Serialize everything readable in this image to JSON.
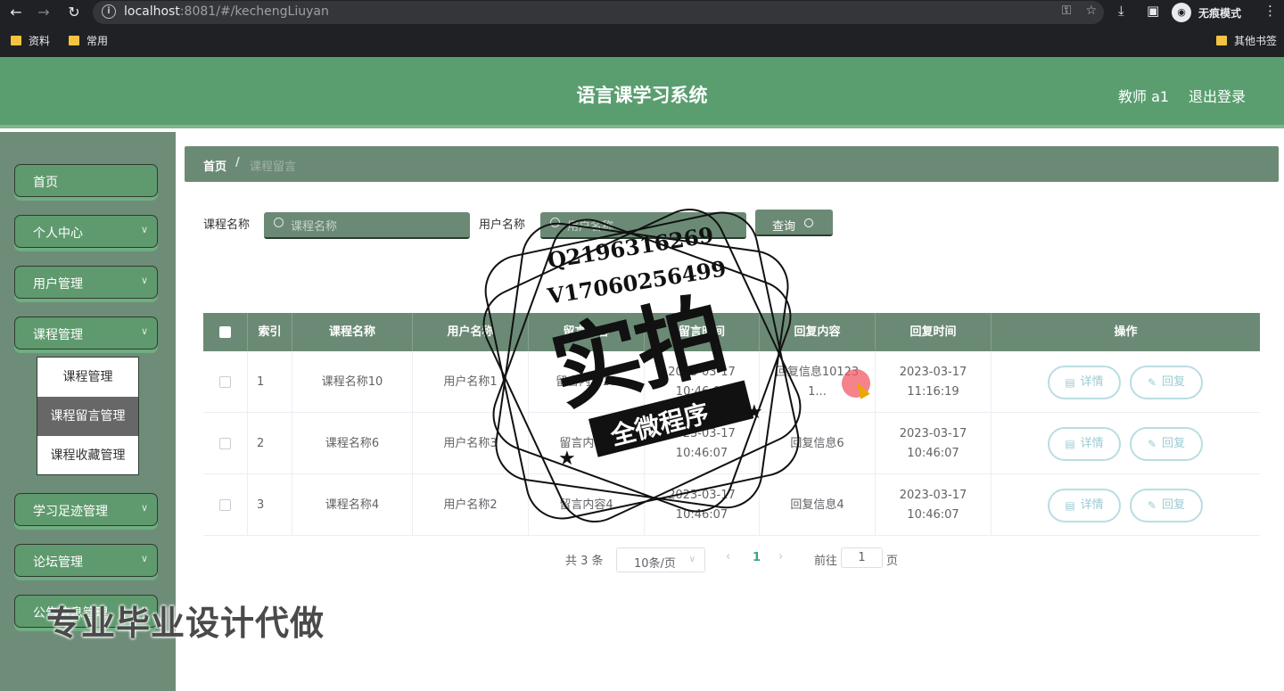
{
  "browser": {
    "url_host": "localhost",
    "url_rest": ":8081/#/kechengLiuyan",
    "incognito_label": "无痕模式",
    "bookmarks": [
      "资料",
      "常用",
      "其他书签"
    ]
  },
  "header": {
    "title": "语言课学习系统",
    "user": "教师 a1",
    "logout": "退出登录"
  },
  "sidebar": {
    "items": [
      {
        "label": "首页",
        "has_chevron": false
      },
      {
        "label": "个人中心",
        "has_chevron": true
      },
      {
        "label": "用户管理",
        "has_chevron": true
      },
      {
        "label": "课程管理",
        "has_chevron": true
      },
      {
        "label": "学习足迹管理",
        "has_chevron": true
      },
      {
        "label": "论坛管理",
        "has_chevron": true
      },
      {
        "label": "公告信息管理",
        "has_chevron": true
      }
    ],
    "submenu": [
      "课程管理",
      "课程留言管理",
      "课程收藏管理"
    ],
    "active_submenu": "课程留言管理"
  },
  "breadcrumb": {
    "home": "首页",
    "separator": "/",
    "current": "课程留言"
  },
  "search": {
    "course_label": "课程名称",
    "course_placeholder": "课程名称",
    "user_label": "用户名称",
    "user_placeholder": "用户名称",
    "query_button": "查询"
  },
  "table": {
    "headers": [
      "索引",
      "课程名称",
      "用户名称",
      "留言内容",
      "留言时间",
      "回复内容",
      "回复时间",
      "操作"
    ],
    "rows": [
      {
        "index": "1",
        "course": "课程名称10",
        "user": "用户名称1",
        "message": "留言内容10",
        "msg_time": "2023-03-17 10:46:07",
        "reply": "回复信息10123 1...",
        "reply_time": "2023-03-17 11:16:19"
      },
      {
        "index": "2",
        "course": "课程名称6",
        "user": "用户名称3",
        "message": "留言内容6",
        "msg_time": "2023-03-17 10:46:07",
        "reply": "回复信息6",
        "reply_time": "2023-03-17 10:46:07"
      },
      {
        "index": "3",
        "course": "课程名称4",
        "user": "用户名称2",
        "message": "留言内容4",
        "msg_time": "2023-03-17 10:46:07",
        "reply": "回复信息4",
        "reply_time": "2023-03-17 10:46:07"
      }
    ],
    "detail_button": "详情",
    "reply_button": "回复"
  },
  "pagination": {
    "total": "共 3 条",
    "page_size": "10条/页",
    "current_page": "1",
    "goto": "前往",
    "goto_value": "1",
    "unit": "页"
  },
  "watermark": {
    "line1": "Q2196316269",
    "line2": "V17060256499",
    "big": "实拍",
    "ribbon": "全微程序",
    "overlay": "专业毕业设计代做"
  }
}
